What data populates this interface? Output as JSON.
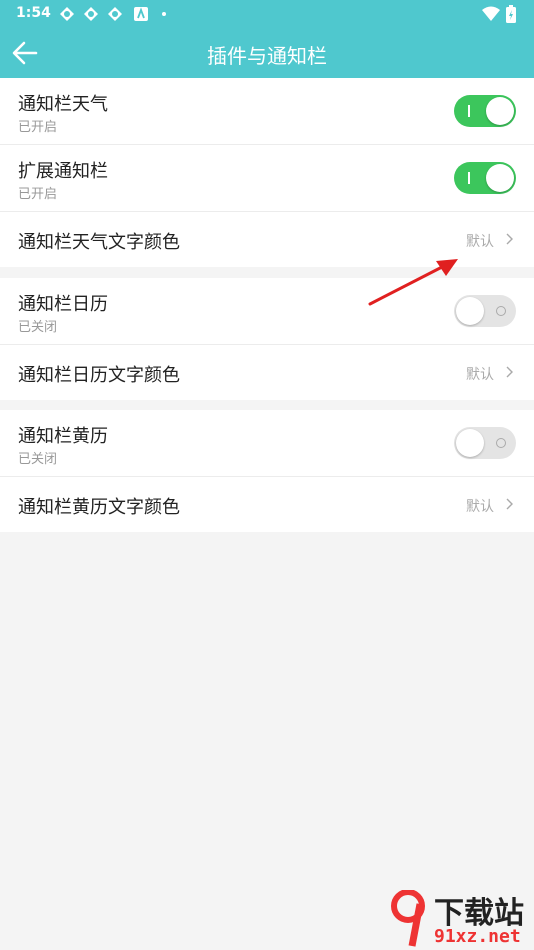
{
  "status": {
    "time": "1:54"
  },
  "appbar": {
    "title": "插件与通知栏"
  },
  "groups": [
    {
      "rows": [
        {
          "label": "通知栏天气",
          "sub": "已开启",
          "toggle": "on"
        },
        {
          "label": "扩展通知栏",
          "sub": "已开启",
          "toggle": "on"
        },
        {
          "label": "通知栏天气文字颜色",
          "value": "默认"
        }
      ]
    },
    {
      "rows": [
        {
          "label": "通知栏日历",
          "sub": "已关闭",
          "toggle": "off"
        },
        {
          "label": "通知栏日历文字颜色",
          "value": "默认"
        }
      ]
    },
    {
      "rows": [
        {
          "label": "通知栏黄历",
          "sub": "已关闭",
          "toggle": "off"
        },
        {
          "label": "通知栏黄历文字颜色",
          "value": "默认"
        }
      ]
    }
  ],
  "watermark": {
    "title": "下载站",
    "url": "91xz.net"
  },
  "colors": {
    "accent": "#4fc8ce",
    "toggle_on": "#3cc65c",
    "toggle_off": "#e4e4e4",
    "annotation": "#e02020"
  },
  "icons": [
    "back-arrow-icon",
    "chevron-right-icon",
    "wifi-icon",
    "battery-icon",
    "notification-icon"
  ]
}
